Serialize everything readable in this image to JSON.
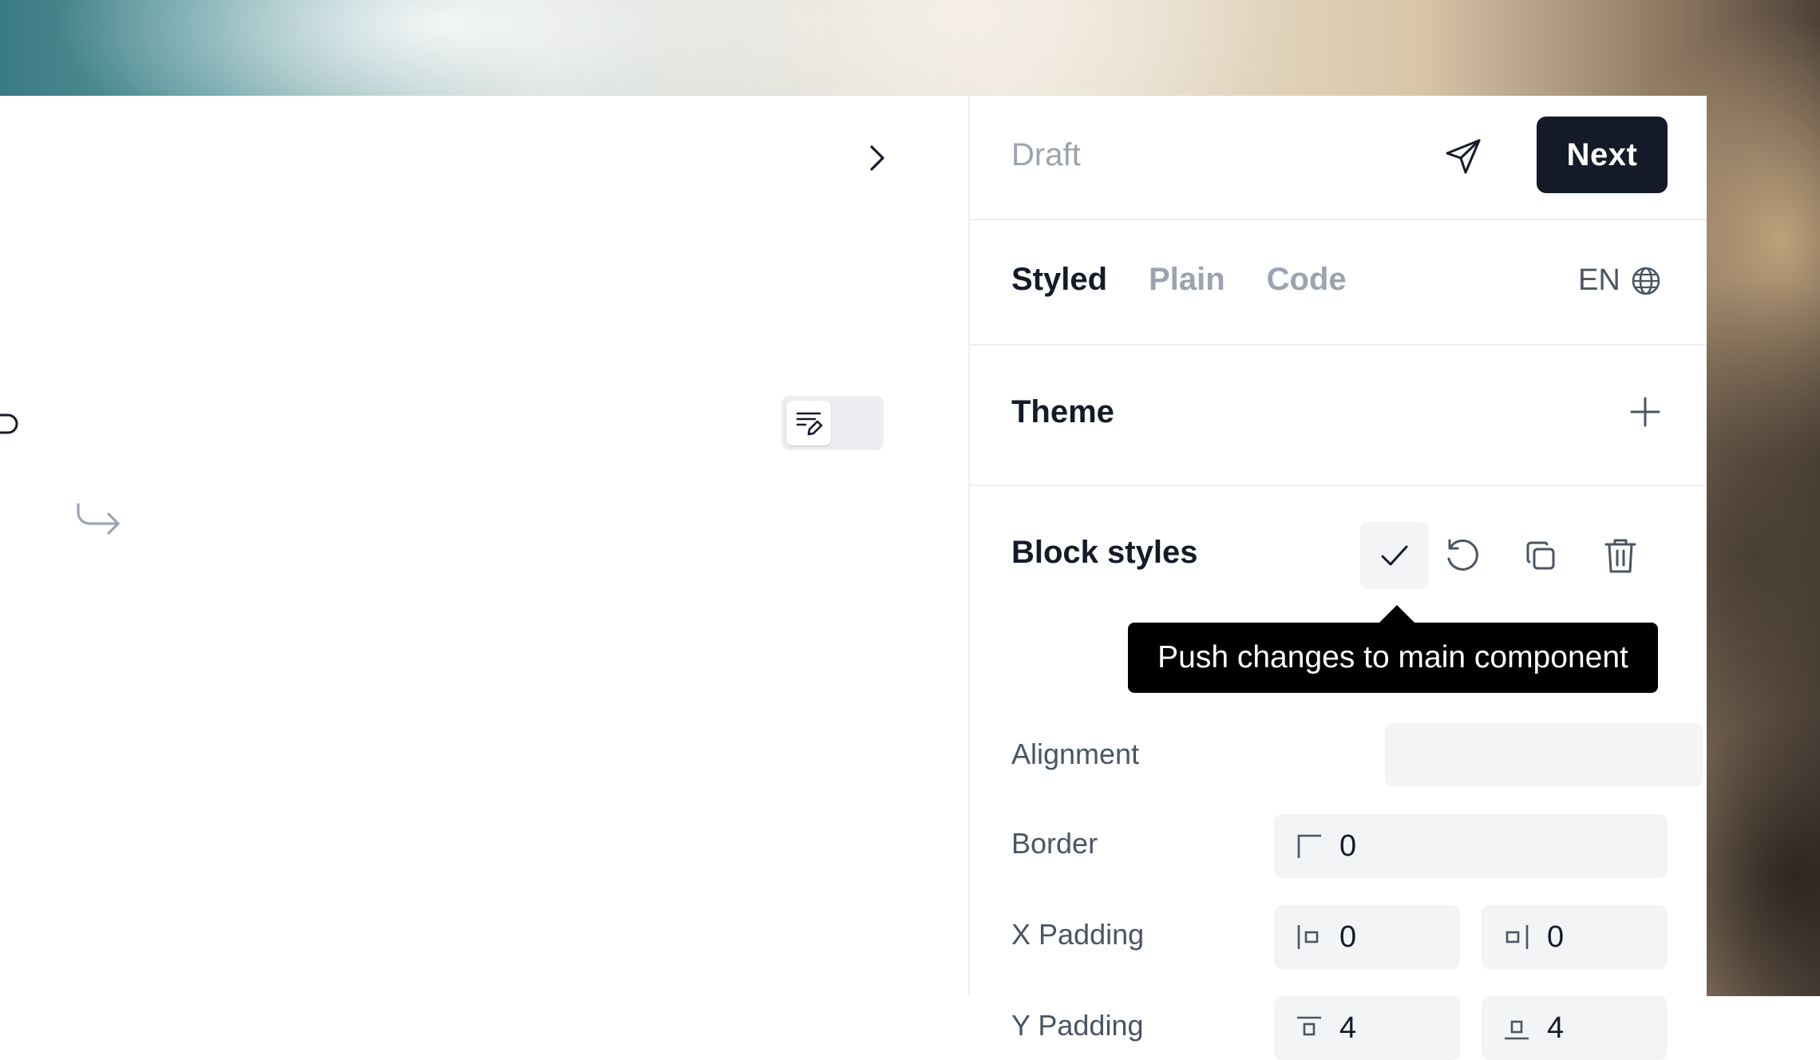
{
  "header": {
    "status": "Draft",
    "next_label": "Next",
    "send_icon": "send-icon"
  },
  "tabs": [
    {
      "label": "Styled",
      "active": true
    },
    {
      "label": "Plain",
      "active": false
    },
    {
      "label": "Code",
      "active": false
    }
  ],
  "language": {
    "code": "EN",
    "icon": "globe-icon"
  },
  "theme": {
    "title": "Theme",
    "add_icon": "plus-icon"
  },
  "block_styles": {
    "title": "Block styles",
    "actions": [
      "check-icon",
      "reset-icon",
      "copy-icon",
      "trash-icon"
    ],
    "tooltip": "Push changes to main component",
    "rows": {
      "alignment_label": "Alignment",
      "border_label": "Border",
      "border_value": "0",
      "x_padding_label": "X Padding",
      "x_padding_left": "0",
      "x_padding_right": "0",
      "y_padding_label": "Y Padding",
      "y_padding_top": "4",
      "y_padding_bottom": "4"
    }
  },
  "canvas": {
    "undo_icon": "undo-icon",
    "redo_icon": "redo-icon",
    "expand_icon": "chevron-right-icon",
    "edit_toggle_icon": "edit-text-icon"
  },
  "colors": {
    "primary_dark": "#151a28",
    "muted_text": "#9ca3af",
    "field_bg": "#f3f4f6"
  }
}
